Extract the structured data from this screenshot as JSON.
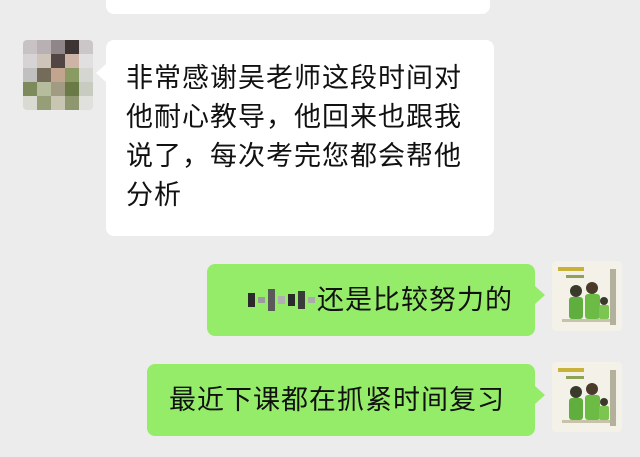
{
  "messages": [
    {
      "side": "incoming",
      "text": "非常感谢吴老师这段时间对他耐心教导，他回来也跟我说了，每次考完您都会帮他分析"
    },
    {
      "side": "outgoing",
      "text": "还是比较努力的"
    },
    {
      "side": "outgoing",
      "text": "最近下课都在抓紧时间复习"
    }
  ],
  "colors": {
    "background": "#ececec",
    "incoming_bubble": "#ffffff",
    "outgoing_bubble": "#95ec69",
    "text": "#111111"
  },
  "icons": {
    "incoming_avatar": "pixelated-avatar",
    "outgoing_avatar": "family-illustration-avatar"
  }
}
